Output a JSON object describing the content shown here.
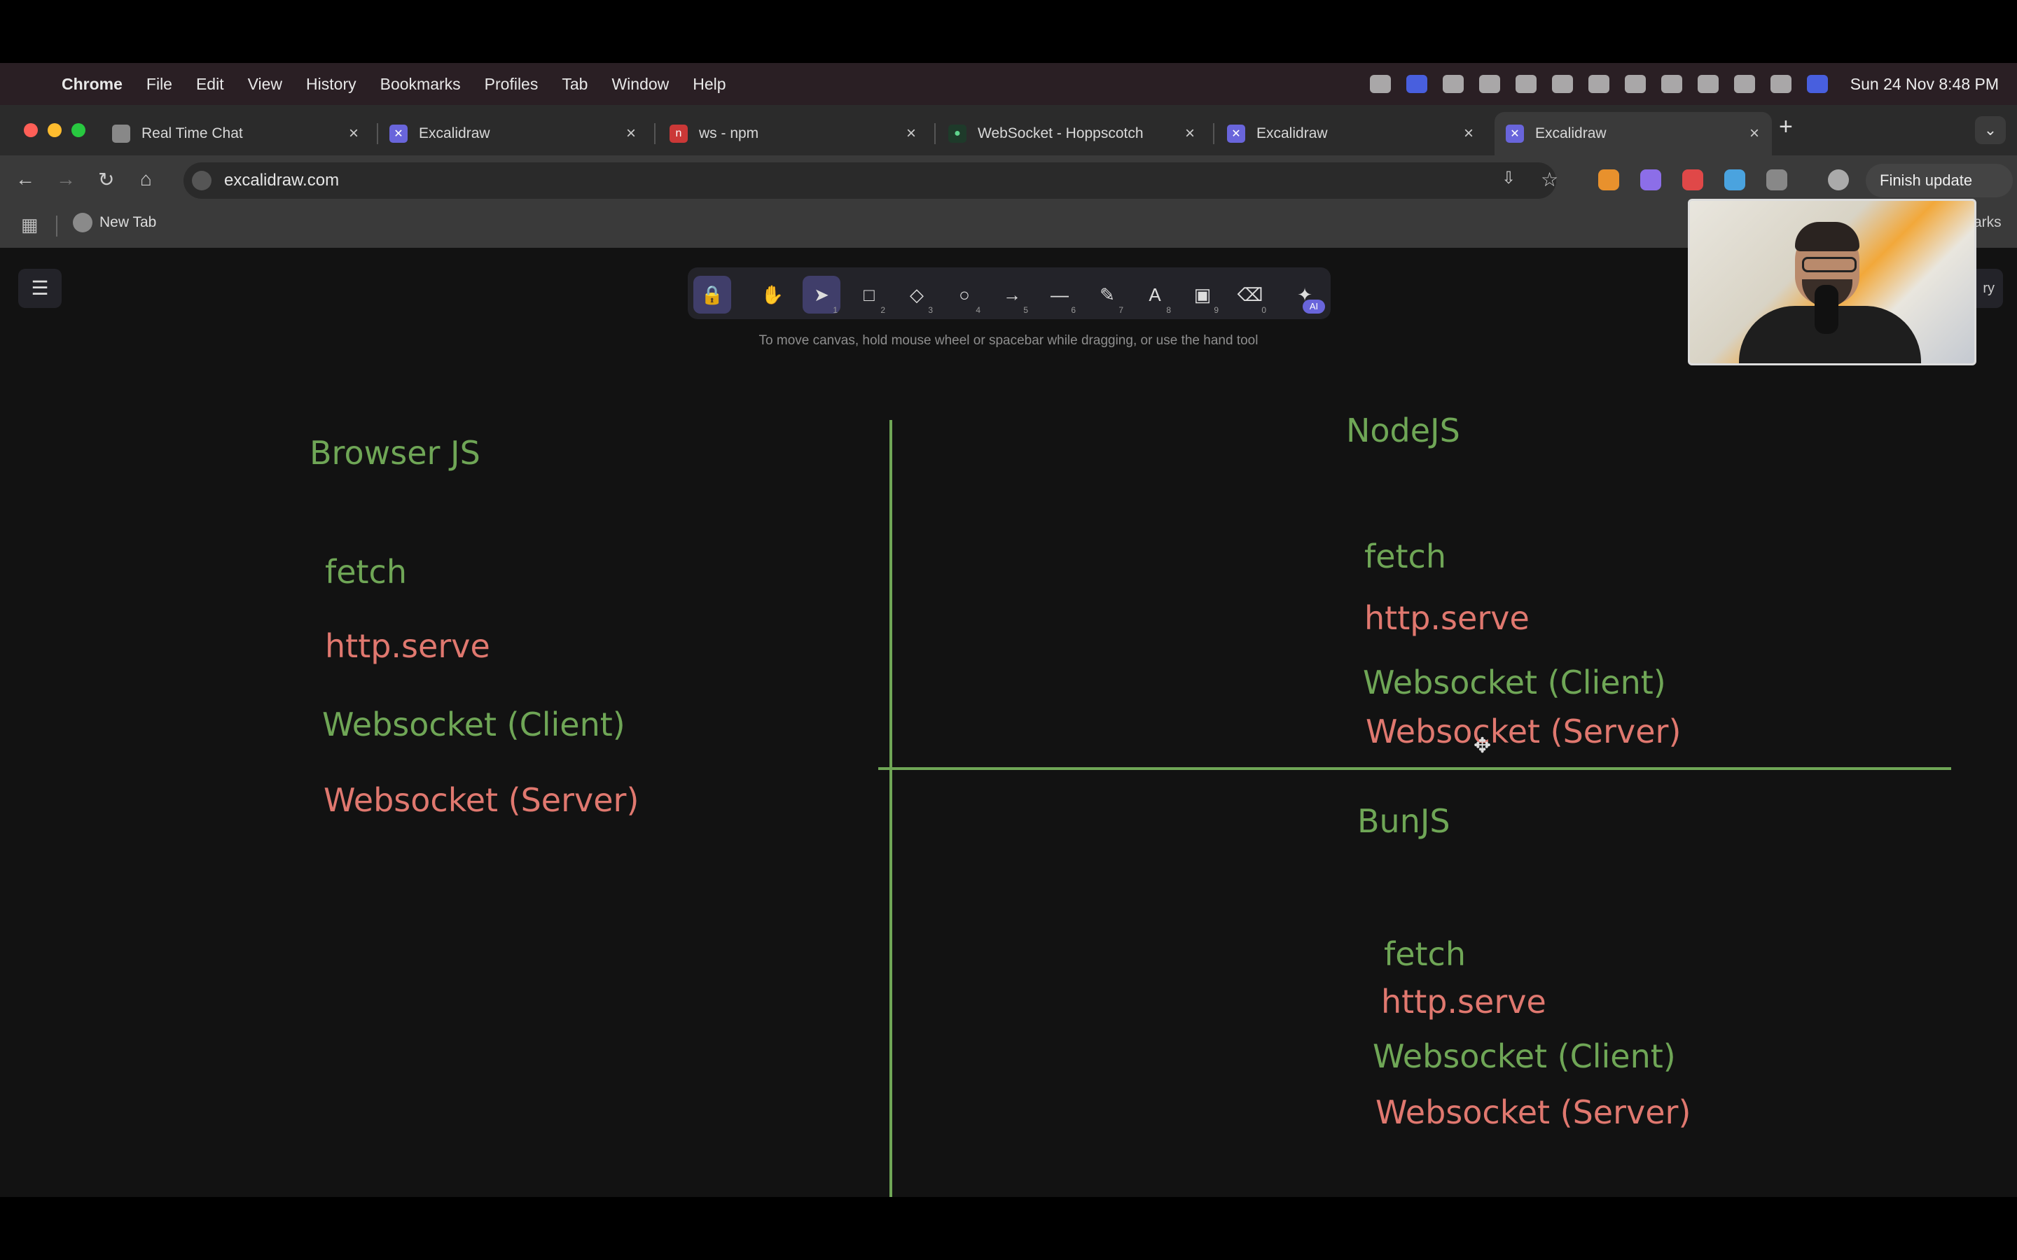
{
  "menubar": {
    "app": "Chrome",
    "items": [
      "File",
      "Edit",
      "View",
      "History",
      "Bookmarks",
      "Profiles",
      "Tab",
      "Window",
      "Help"
    ],
    "clock": "Sun 24 Nov  8:48 PM"
  },
  "tabs": [
    {
      "label": "Real Time Chat",
      "favicon": "page-icon"
    },
    {
      "label": "Excalidraw",
      "favicon": "excalidraw-icon"
    },
    {
      "label": "ws - npm",
      "favicon": "npm-icon"
    },
    {
      "label": "WebSocket - Hoppscotch",
      "favicon": "hoppscotch-icon"
    },
    {
      "label": "Excalidraw",
      "favicon": "excalidraw-icon"
    },
    {
      "label": "Excalidraw",
      "favicon": "excalidraw-icon"
    }
  ],
  "toolbar": {
    "url": "excalidraw.com",
    "finish_update": "Finish update"
  },
  "bookmarks": {
    "new_tab": "New Tab",
    "other": "arks"
  },
  "excalidraw": {
    "hint": "To move canvas, hold mouse wheel or spacebar while dragging, or use the hand tool",
    "tools": [
      {
        "name": "lock-tool",
        "icon": "🔒",
        "key": ""
      },
      {
        "name": "hand-tool",
        "icon": "✋",
        "key": ""
      },
      {
        "name": "selection-tool",
        "icon": "➤",
        "key": "1"
      },
      {
        "name": "rectangle-tool",
        "icon": "□",
        "key": "2"
      },
      {
        "name": "diamond-tool",
        "icon": "◇",
        "key": "3"
      },
      {
        "name": "ellipse-tool",
        "icon": "○",
        "key": "4"
      },
      {
        "name": "arrow-tool",
        "icon": "→",
        "key": "5"
      },
      {
        "name": "line-tool",
        "icon": "—",
        "key": "6"
      },
      {
        "name": "draw-tool",
        "icon": "✎",
        "key": "7"
      },
      {
        "name": "text-tool",
        "icon": "A",
        "key": "8"
      },
      {
        "name": "image-tool",
        "icon": "▣",
        "key": "9"
      },
      {
        "name": "eraser-tool",
        "icon": "⌫",
        "key": "0"
      },
      {
        "name": "extra-tools",
        "icon": "✦",
        "key": ""
      }
    ],
    "library_label": "ry"
  },
  "drawing": {
    "browser": {
      "title": "Browser JS",
      "items": [
        "fetch",
        "http.serve",
        "Websocket (Client)",
        "Websocket (Server)"
      ]
    },
    "node": {
      "title": "NodeJS",
      "items": [
        "fetch",
        "http.serve",
        "Websocket (Client)",
        "Websocket (Server)"
      ]
    },
    "bun": {
      "title": "BunJS",
      "items": [
        "fetch",
        "http.serve",
        "Websocket (Client)",
        "Websocket (Server)"
      ]
    }
  },
  "colors": {
    "green": "#6fa656",
    "pink": "#e0786f",
    "canvas": "#121212"
  }
}
